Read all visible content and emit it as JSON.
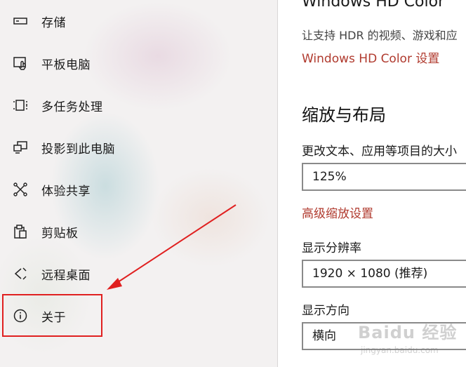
{
  "sidebar": {
    "items": [
      {
        "label": "存储",
        "icon": "storage-icon"
      },
      {
        "label": "平板电脑",
        "icon": "tablet-icon"
      },
      {
        "label": "多任务处理",
        "icon": "multitasking-icon"
      },
      {
        "label": "投影到此电脑",
        "icon": "project-icon"
      },
      {
        "label": "体验共享",
        "icon": "share-icon"
      },
      {
        "label": "剪贴板",
        "icon": "clipboard-icon"
      },
      {
        "label": "远程桌面",
        "icon": "remote-desktop-icon"
      },
      {
        "label": "关于",
        "icon": "info-icon"
      }
    ]
  },
  "content": {
    "hd_title": "Windows HD Color",
    "hd_desc": "让支持 HDR 的视频、游戏和应",
    "hd_link": "Windows HD Color 设置",
    "section_title": "缩放与布局",
    "scale_label": "更改文本、应用等项目的大小",
    "scale_value": "125%",
    "advanced_link": "高级缩放设置",
    "resolution_label": "显示分辨率",
    "resolution_value": "1920 × 1080 (推荐)",
    "orientation_label": "显示方向",
    "orientation_value": "横向"
  },
  "watermark": {
    "main": "Baidu 经验",
    "sub": "jingyan.baidu.com"
  },
  "colors": {
    "link": "#b03a2e",
    "annotation": "#e02020"
  }
}
